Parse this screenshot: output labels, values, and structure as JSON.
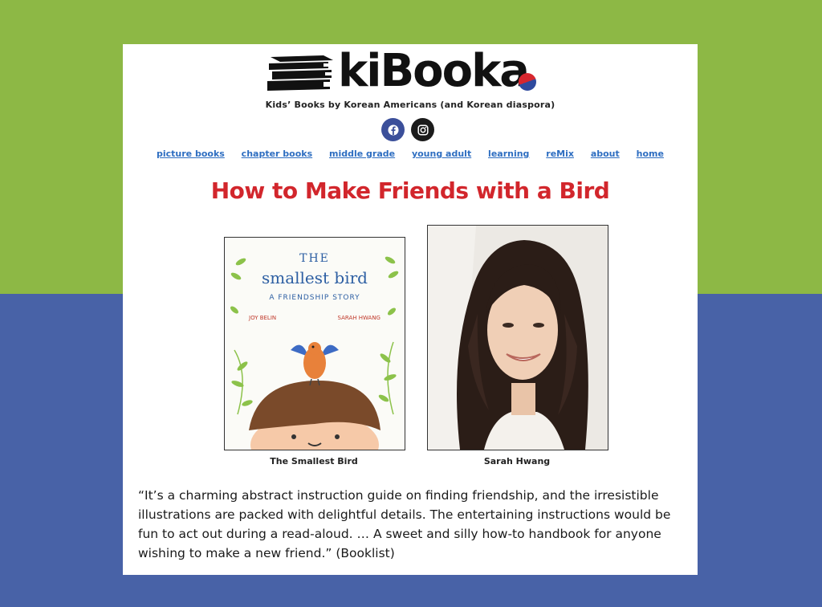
{
  "site": {
    "logo_text": "kiBooka",
    "tagline": "Kids’ Books by Korean Americans (and Korean diaspora)"
  },
  "social": [
    {
      "name": "facebook-icon"
    },
    {
      "name": "instagram-icon"
    }
  ],
  "nav": [
    "picture books",
    "chapter books",
    "middle grade",
    "young adult",
    "learning",
    "reMix",
    "about",
    "home"
  ],
  "page": {
    "title": "How to Make Friends with a Bird"
  },
  "book_cover": {
    "the": "THE",
    "title": "smallest bird",
    "subtitle": "A FRIENDSHIP STORY",
    "author": "JOY BELIN",
    "illustrator": "SARAH HWANG",
    "caption": "The Smallest Bird"
  },
  "photo": {
    "caption": "Sarah Hwang"
  },
  "review": {
    "text": "“It’s a charming abstract instruction guide on finding friendship, and the irresistible illustrations are packed with delightful details. The entertaining instructions would be fun to act out during a read-aloud. … A sweet and silly how-to handbook for anyone wishing to make a new friend.” (Booklist)"
  },
  "colors": {
    "bg_green": "#8db845",
    "bg_blue": "#4862a7",
    "title_red": "#d2262c",
    "link_blue": "#2e6ec1"
  }
}
